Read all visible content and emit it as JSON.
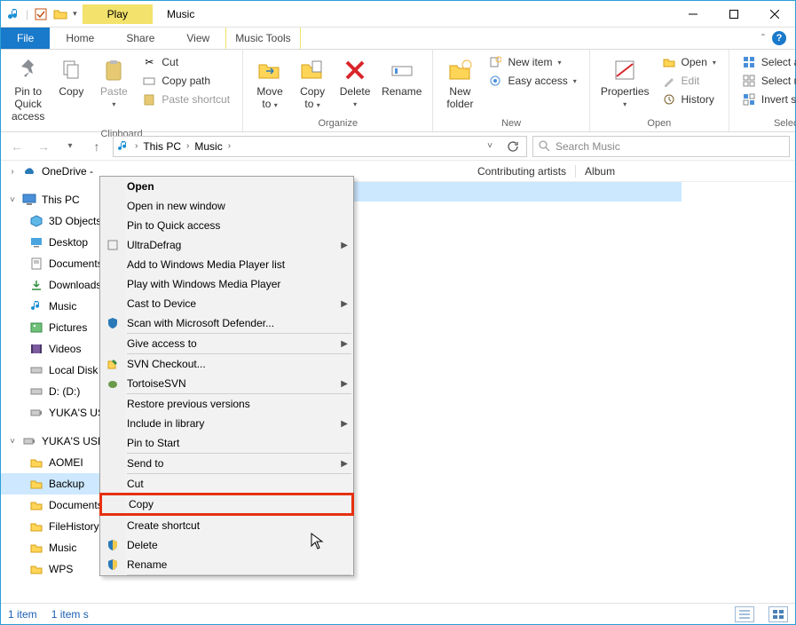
{
  "window": {
    "title": "Music",
    "play_tab": "Play",
    "music_tools_tab": "Music Tools"
  },
  "menutabs": {
    "file": "File",
    "home": "Home",
    "share": "Share",
    "view": "View"
  },
  "ribbon": {
    "clipboard": {
      "label": "Clipboard",
      "pin": "Pin to Quick\naccess",
      "copy": "Copy",
      "paste": "Paste",
      "cut": "Cut",
      "copy_path": "Copy path",
      "paste_shortcut": "Paste shortcut"
    },
    "organize": {
      "label": "Organize",
      "move_to": "Move\nto",
      "copy_to": "Copy\nto",
      "delete": "Delete",
      "rename": "Rename"
    },
    "new": {
      "label": "New",
      "new_folder": "New\nfolder",
      "new_item": "New item",
      "easy_access": "Easy access"
    },
    "open": {
      "label": "Open",
      "properties": "Properties",
      "open": "Open",
      "edit": "Edit",
      "history": "History"
    },
    "select": {
      "label": "Select",
      "select_all": "Select all",
      "select_none": "Select none",
      "invert": "Invert selection"
    }
  },
  "address": {
    "this_pc": "This PC",
    "music": "Music"
  },
  "search": {
    "placeholder": "Search Music"
  },
  "nav": {
    "onedrive": "OneDrive - ",
    "this_pc": "This PC",
    "objects3d": "3D Objects",
    "desktop": "Desktop",
    "documents": "Documents",
    "downloads": "Downloads",
    "music": "Music",
    "pictures": "Pictures",
    "videos": "Videos",
    "local_disk": "Local Disk",
    "drive_d": "D: (D:)",
    "yukas_us": "YUKA'S US",
    "yukas_usb": "YUKA'S USB",
    "aomei": "AOMEI",
    "backup": "Backup",
    "documents2": "Documents",
    "filehistory": "FileHistory",
    "music2": "Music",
    "wps": "WPS"
  },
  "columns": {
    "contributing": "Contributing artists",
    "album": "Album"
  },
  "context_menu": {
    "open": "Open",
    "open_new_window": "Open in new window",
    "pin_quick": "Pin to Quick access",
    "ultradefrag": "UltraDefrag",
    "add_wmp_list": "Add to Windows Media Player list",
    "play_wmp": "Play with Windows Media Player",
    "cast": "Cast to Device",
    "scan_defender": "Scan with Microsoft Defender...",
    "give_access": "Give access to",
    "svn_checkout": "SVN Checkout...",
    "tortoise": "TortoiseSVN",
    "restore": "Restore previous versions",
    "include_library": "Include in library",
    "pin_start": "Pin to Start",
    "send_to": "Send to",
    "cut": "Cut",
    "copy": "Copy",
    "create_shortcut": "Create shortcut",
    "delete": "Delete",
    "rename": "Rename"
  },
  "status": {
    "items": "1 item",
    "selected": "1 item s"
  }
}
